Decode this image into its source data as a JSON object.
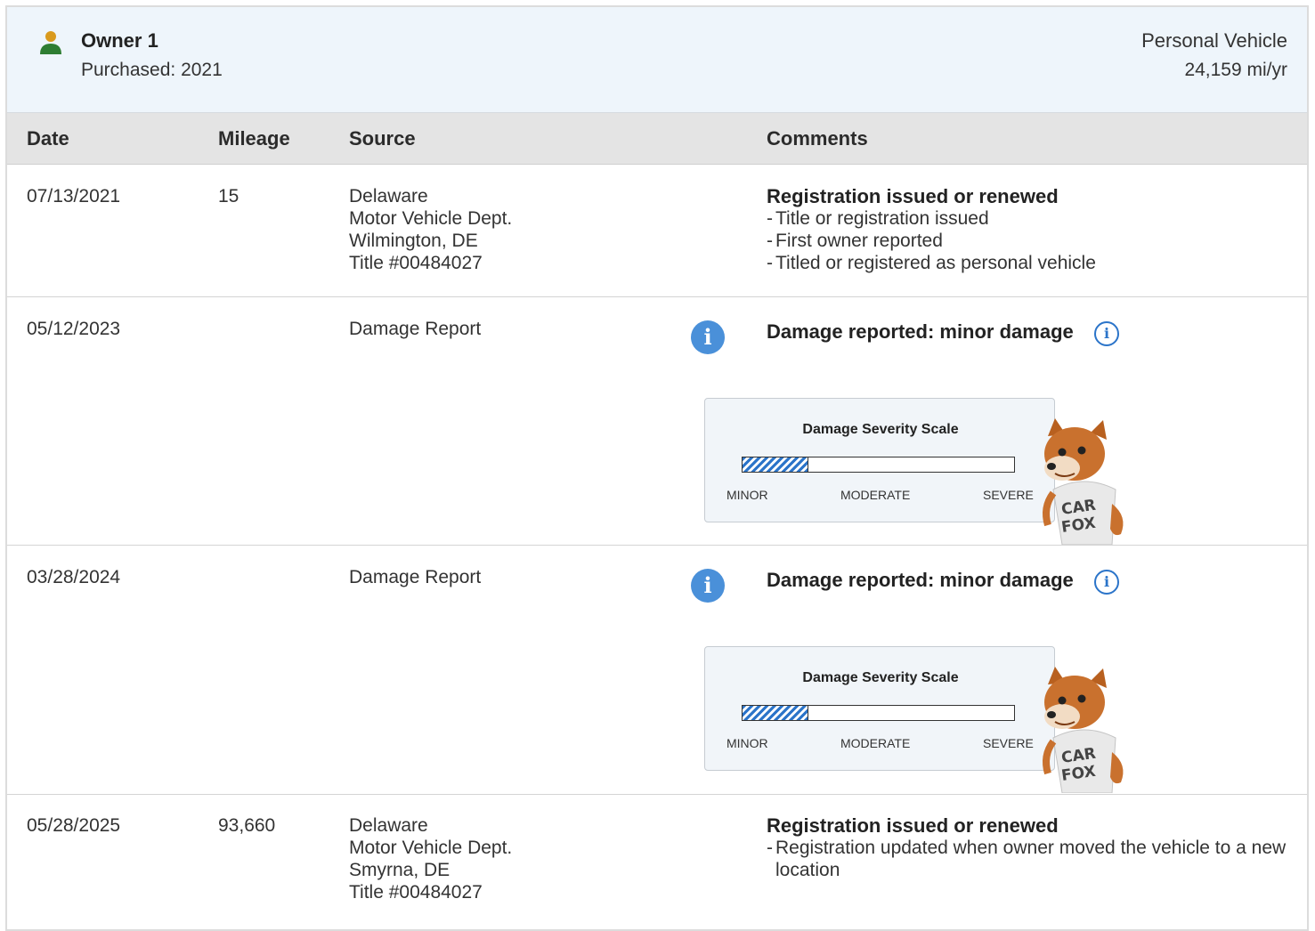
{
  "owner": {
    "name": "Owner 1",
    "purchased": "Purchased: 2021",
    "use": "Personal Vehicle",
    "miles_per_year": "24,159 mi/yr"
  },
  "columns": {
    "date": "Date",
    "mileage": "Mileage",
    "source": "Source",
    "comments": "Comments"
  },
  "colors": {
    "header_bg": "#eef5fb",
    "table_head_bg": "#e4e4e4",
    "info_blue": "#4a90d9",
    "owner_icon_body": "#2e7d32",
    "owner_icon_head": "#d99a1e"
  },
  "records": [
    {
      "date": "07/13/2021",
      "mileage": "15",
      "source": [
        "Delaware",
        "Motor Vehicle Dept.",
        "Wilmington, DE",
        "Title #00484027"
      ],
      "comment_title": "Registration issued or renewed",
      "comment_items": [
        "Title or registration issued",
        "First owner reported",
        "Titled or registered as personal vehicle"
      ]
    },
    {
      "date": "05/12/2023",
      "source": "Damage Report",
      "comment_title": "Damage reported: minor damage",
      "scale": {
        "title": "Damage Severity Scale",
        "level": 0.24,
        "labels": [
          "MINOR",
          "MODERATE",
          "SEVERE"
        ]
      }
    },
    {
      "date": "03/28/2024",
      "source": "Damage Report",
      "comment_title": "Damage reported: minor damage",
      "scale": {
        "title": "Damage Severity Scale",
        "level": 0.24,
        "labels": [
          "MINOR",
          "MODERATE",
          "SEVERE"
        ]
      }
    },
    {
      "date": "05/28/2025",
      "mileage": "93,660",
      "source": [
        "Delaware",
        "Motor Vehicle Dept.",
        "Smyrna, DE",
        "Title #00484027"
      ],
      "comment_title": "Registration issued or renewed",
      "comment_items": [
        "Registration updated when owner moved the vehicle to a new location"
      ]
    }
  ],
  "mascot": {
    "shirt_text": [
      "CAR",
      "FOX"
    ]
  }
}
